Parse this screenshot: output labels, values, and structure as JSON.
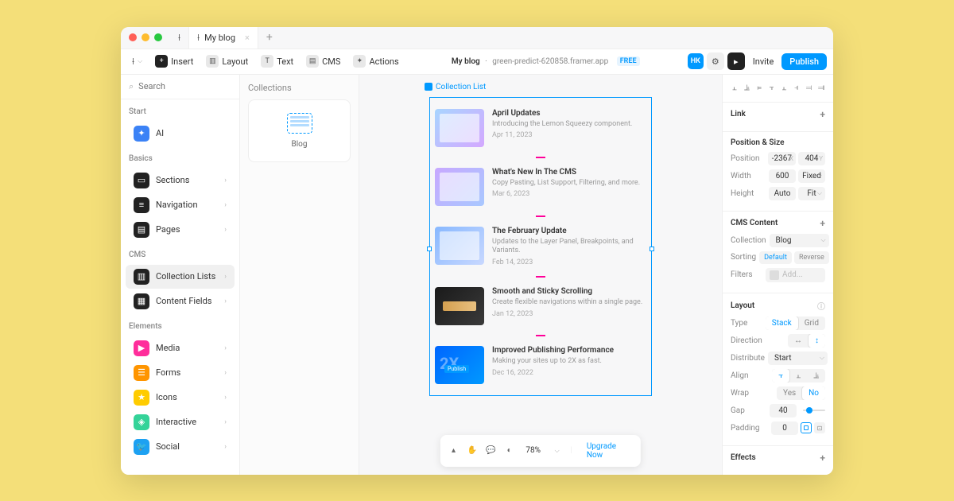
{
  "tabs": {
    "app": "F",
    "active": "My blog"
  },
  "toolbar": {
    "insert": "Insert",
    "layout": "Layout",
    "text": "Text",
    "cms": "CMS",
    "actions": "Actions",
    "project": "My blog",
    "domain": "green-predict-620858.framer.app",
    "free": "FREE",
    "avatar": "HK",
    "invite": "Invite",
    "publish": "Publish"
  },
  "search_placeholder": "Search",
  "sidebar": {
    "start": "Start",
    "ai": "AI",
    "basics": "Basics",
    "basics_items": [
      {
        "label": "Sections",
        "color": "#222"
      },
      {
        "label": "Navigation",
        "color": "#222"
      },
      {
        "label": "Pages",
        "color": "#222"
      }
    ],
    "cms": "CMS",
    "cms_items": [
      {
        "label": "Collection Lists",
        "color": "#222",
        "selected": true
      },
      {
        "label": "Content Fields",
        "color": "#222"
      }
    ],
    "elements": "Elements",
    "elements_items": [
      {
        "label": "Media",
        "color": "#ff2d9b"
      },
      {
        "label": "Forms",
        "color": "#ff9500"
      },
      {
        "label": "Icons",
        "color": "#ffcc00"
      },
      {
        "label": "Interactive",
        "color": "#34d399"
      },
      {
        "label": "Social",
        "color": "#1da1f2"
      }
    ]
  },
  "collections": {
    "title": "Collections",
    "item": "Blog"
  },
  "canvas_label": "Collection List",
  "posts": [
    {
      "title": "April Updates",
      "excerpt": "Introducing the Lemon Squeezy component.",
      "date": "Apr 11, 2023",
      "thumb": "t1"
    },
    {
      "title": "What's New In The CMS",
      "excerpt": "Copy Pasting, List Support, Filtering, and more.",
      "date": "Mar 6, 2023",
      "thumb": "t2"
    },
    {
      "title": "The February Update",
      "excerpt": "Updates to the Layer Panel, Breakpoints, and Variants.",
      "date": "Feb 14, 2023",
      "thumb": "t3"
    },
    {
      "title": "Smooth and Sticky Scrolling",
      "excerpt": "Create flexible navigations within a single page.",
      "date": "Jan 12, 2023",
      "thumb": "t4"
    },
    {
      "title": "Improved Publishing Performance",
      "excerpt": "Making your sites up to 2X as fast.",
      "date": "Dec 16, 2022",
      "thumb": "t5"
    }
  ],
  "bottombar": {
    "zoom": "78%",
    "upgrade": "Upgrade Now"
  },
  "props": {
    "link": "Link",
    "possize": "Position & Size",
    "position_l": "Position",
    "pos_x": "-2367",
    "pos_y": "404",
    "width_l": "Width",
    "width_v": "600",
    "width_m": "Fixed",
    "height_l": "Height",
    "height_v": "Auto",
    "height_m": "Fit",
    "cms": "CMS Content",
    "collection_l": "Collection",
    "collection_v": "Blog",
    "sorting_l": "Sorting",
    "sort_def": "Default",
    "sort_rev": "Reverse",
    "filters_l": "Filters",
    "filters_add": "Add...",
    "layout": "Layout",
    "type_l": "Type",
    "type_stack": "Stack",
    "type_grid": "Grid",
    "direction_l": "Direction",
    "distribute_l": "Distribute",
    "distribute_v": "Start",
    "align_l": "Align",
    "wrap_l": "Wrap",
    "wrap_yes": "Yes",
    "wrap_no": "No",
    "gap_l": "Gap",
    "gap_v": "40",
    "padding_l": "Padding",
    "padding_v": "0",
    "effects": "Effects"
  }
}
